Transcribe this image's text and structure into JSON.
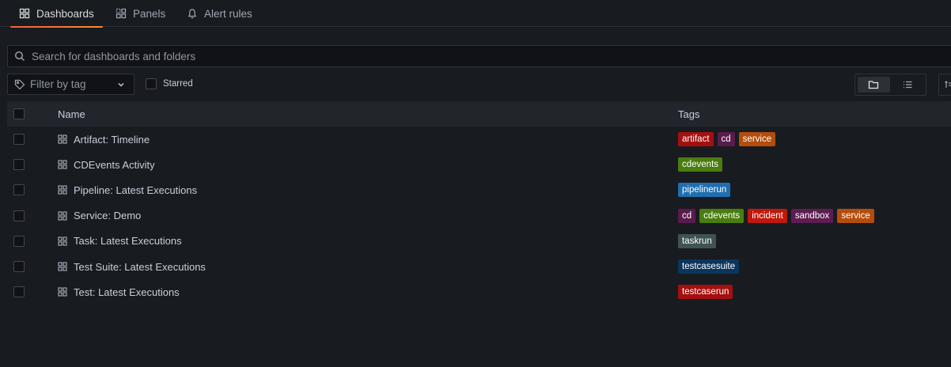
{
  "tabs": [
    {
      "label": "Dashboards",
      "icon": "dashboards-grid-icon",
      "active": true
    },
    {
      "label": "Panels",
      "icon": "panels-icon",
      "active": false
    },
    {
      "label": "Alert rules",
      "icon": "bell-icon",
      "active": false
    }
  ],
  "search": {
    "placeholder": "Search for dashboards and folders"
  },
  "filter": {
    "tag_label": "Filter by tag",
    "starred_label": "Starred"
  },
  "table": {
    "headers": {
      "name": "Name",
      "tags": "Tags"
    },
    "rows": [
      {
        "title": "Artifact: Timeline",
        "tags": [
          "artifact",
          "cd",
          "service"
        ]
      },
      {
        "title": "CDEvents Activity",
        "tags": [
          "cdevents"
        ]
      },
      {
        "title": "Pipeline: Latest Executions",
        "tags": [
          "pipelinerun"
        ]
      },
      {
        "title": "Service: Demo",
        "tags": [
          "cd",
          "cdevents",
          "incident",
          "sandbox",
          "service"
        ]
      },
      {
        "title": "Task: Latest Executions",
        "tags": [
          "taskrun"
        ]
      },
      {
        "title": "Test Suite: Latest Executions",
        "tags": [
          "testcasesuite"
        ]
      },
      {
        "title": "Test: Latest Executions",
        "tags": [
          "testcaserun"
        ]
      }
    ]
  },
  "tag_colors": {
    "artifact": "#a31010",
    "cd": "#5b1a4c",
    "service": "#b34d0c",
    "cdevents": "#4a7d0f",
    "pipelinerun": "#1f6fb0",
    "incident": "#c1180c",
    "sandbox": "#5e1d52",
    "taskrun": "#3f5355",
    "testcasesuite": "#0b355c",
    "testcaserun": "#a3100e"
  }
}
